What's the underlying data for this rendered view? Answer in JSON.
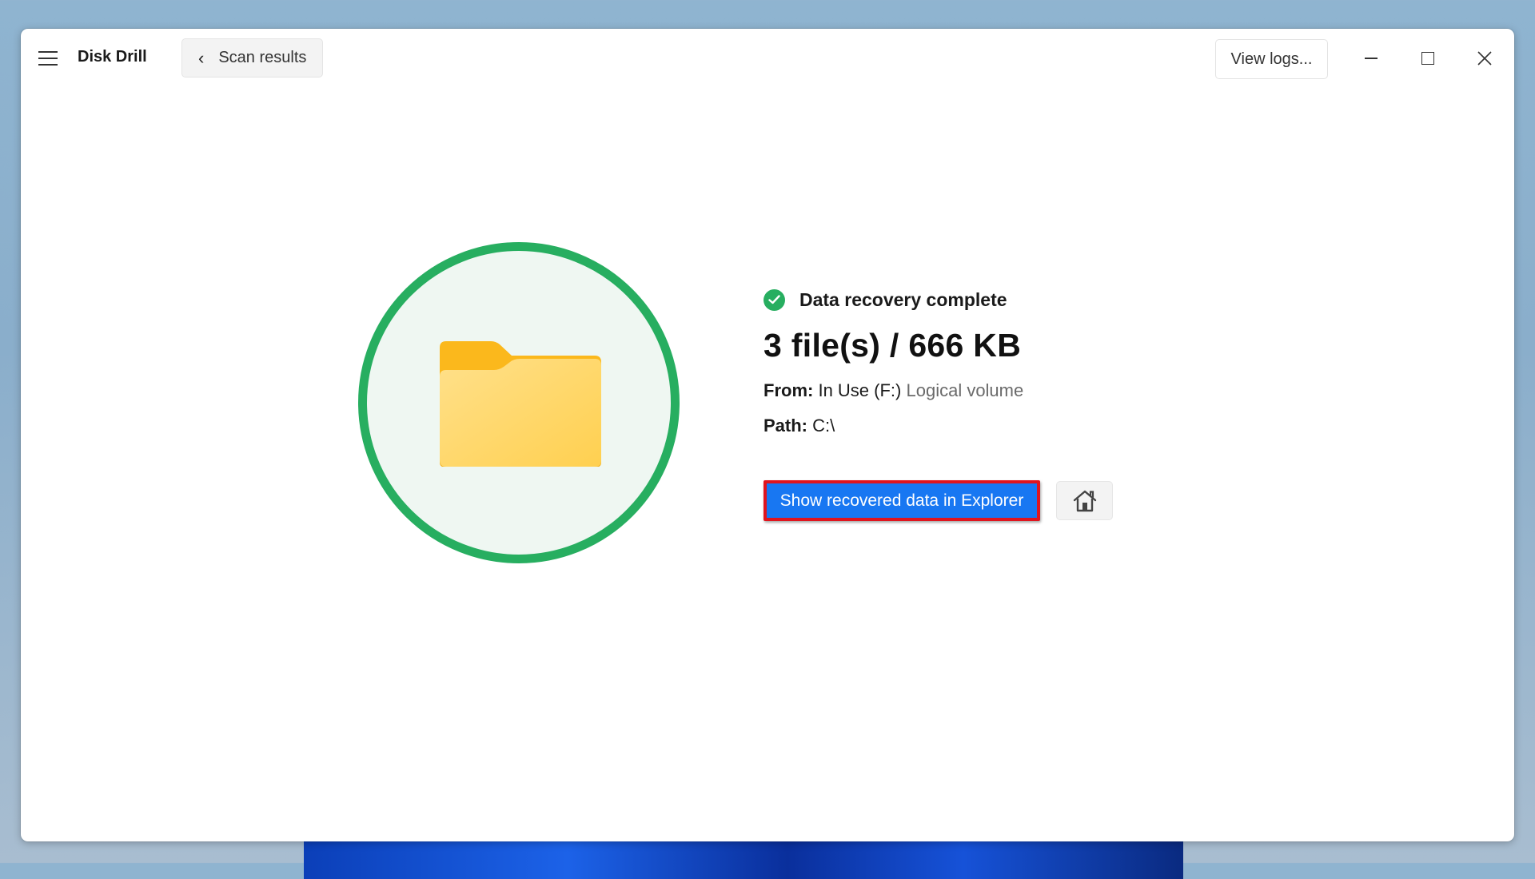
{
  "window": {
    "app_title": "Disk Drill",
    "back_button_label": "Scan results",
    "view_logs_label": "View logs...",
    "controls": {
      "minimize": "minimize-icon",
      "maximize": "maximize-icon",
      "close": "close-icon"
    }
  },
  "result": {
    "status": "Data recovery complete",
    "summary": "3 file(s) / 666 KB",
    "from_label": "From:",
    "from_value": "In Use (F:)",
    "from_type": "Logical volume",
    "path_label": "Path:",
    "path_value": "C:\\",
    "primary_action": "Show recovered data in Explorer",
    "home_icon": "home-icon",
    "illustration_icon": "folder-icon"
  },
  "colors": {
    "accent_green": "#27ae60",
    "primary_blue": "#1877f2",
    "highlight_red": "#e0141e",
    "folder_yellow": "#ffd566"
  }
}
